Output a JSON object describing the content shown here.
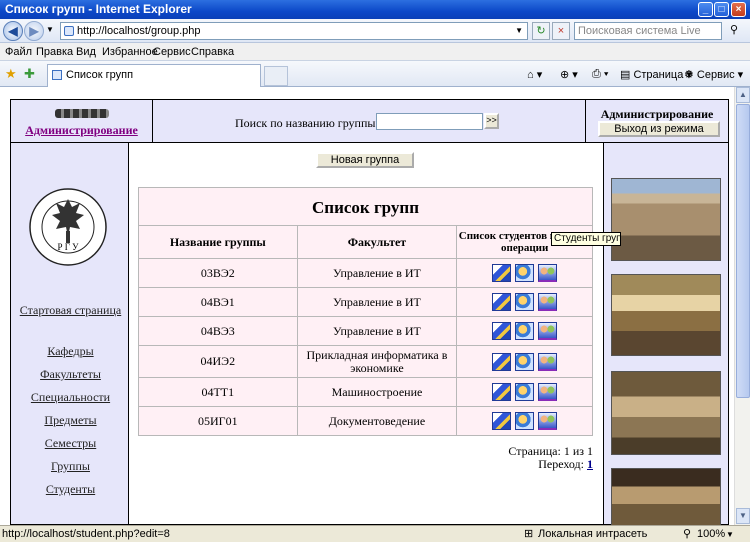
{
  "window": {
    "title": "Список групп - Internet Explorer"
  },
  "address": {
    "url": "http://localhost/group.php",
    "search_placeholder": "Поисковая система Live"
  },
  "menu": [
    "Файл",
    "Правка",
    "Вид",
    "Избранное",
    "Сервис",
    "Справка"
  ],
  "tab": {
    "title": "Список групп"
  },
  "commandbar": {
    "page": "Страница",
    "tools": "Сервис"
  },
  "header": {
    "admin_link": "Администрирование",
    "search_label": "Поиск по названию группы",
    "search_value": "",
    "search_button": ">>",
    "admin_title": "Администрирование",
    "exit_button": "Выход из режима"
  },
  "sidebar": {
    "logo_letters": "Р Г У",
    "items": [
      "Стартовая страница",
      "Кафедры",
      "Факультеты",
      "Специальности",
      "Предметы",
      "Семестры",
      "Группы",
      "Студенты"
    ]
  },
  "content": {
    "new_group_button": "Новая группа",
    "table_title": "Список групп",
    "columns": [
      "Название группы",
      "Факультет",
      "Список студентов группы/операции"
    ],
    "rows": [
      {
        "name": "03ВЭ2",
        "faculty": "Управление в ИТ"
      },
      {
        "name": "04ВЭ1",
        "faculty": "Управление в ИТ"
      },
      {
        "name": "04ВЭ3",
        "faculty": "Управление в ИТ"
      },
      {
        "name": "04ИЭ2",
        "faculty": "Прикладная информатика в экономике"
      },
      {
        "name": "04ТТ1",
        "faculty": "Машиностроение"
      },
      {
        "name": "05ИГ01",
        "faculty": "Документоведение"
      }
    ],
    "pager_text": "Страница: 1 из 1",
    "goto_label": "Переход:",
    "goto_page": "1",
    "tooltip": "Студенты группы"
  },
  "status": {
    "url": "http://localhost/student.php?edit=8",
    "zone": "Локальная интрасеть",
    "zoom": "100%"
  }
}
